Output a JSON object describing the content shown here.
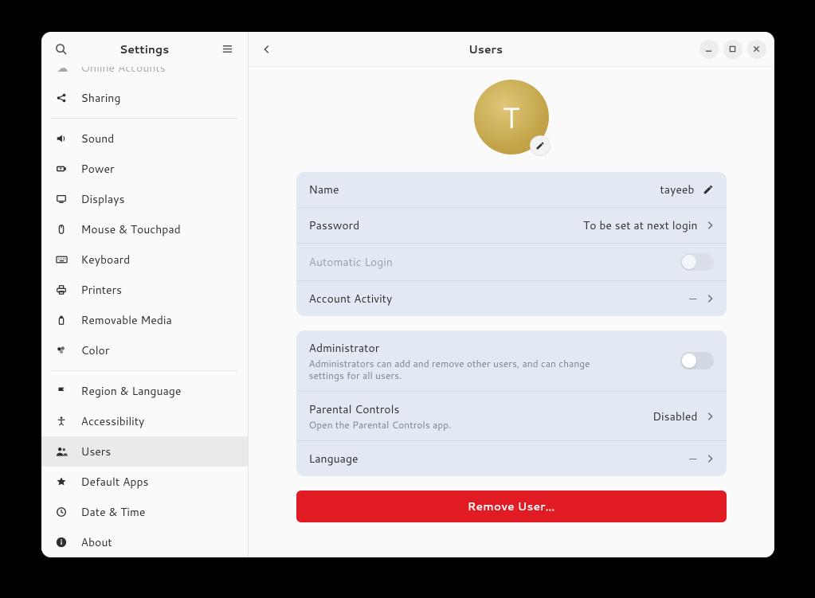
{
  "sidebar": {
    "title": "Settings",
    "items": [
      {
        "id": "online-accounts",
        "label": "Online Accounts",
        "icon": "cloud"
      },
      {
        "id": "sharing",
        "label": "Sharing",
        "icon": "share"
      },
      null,
      {
        "id": "sound",
        "label": "Sound",
        "icon": "speaker"
      },
      {
        "id": "power",
        "label": "Power",
        "icon": "power"
      },
      {
        "id": "displays",
        "label": "Displays",
        "icon": "display"
      },
      {
        "id": "mouse",
        "label": "Mouse & Touchpad",
        "icon": "mouse"
      },
      {
        "id": "keyboard",
        "label": "Keyboard",
        "icon": "keyboard"
      },
      {
        "id": "printers",
        "label": "Printers",
        "icon": "printer"
      },
      {
        "id": "removable",
        "label": "Removable Media",
        "icon": "usb"
      },
      {
        "id": "color",
        "label": "Color",
        "icon": "palette"
      },
      null,
      {
        "id": "region",
        "label": "Region & Language",
        "icon": "flag"
      },
      {
        "id": "accessibility",
        "label": "Accessibility",
        "icon": "a11y"
      },
      {
        "id": "users",
        "label": "Users",
        "icon": "users"
      },
      {
        "id": "default-apps",
        "label": "Default Apps",
        "icon": "star"
      },
      {
        "id": "datetime",
        "label": "Date & Time",
        "icon": "clock"
      },
      {
        "id": "about",
        "label": "About",
        "icon": "info"
      }
    ],
    "active": "users"
  },
  "header": {
    "title": "Users"
  },
  "user": {
    "initial": "T",
    "name_label": "Name",
    "name_value": "tayeeb",
    "password_label": "Password",
    "password_value": "To be set at next login",
    "autologin_label": "Automatic Login",
    "autologin_enabled": false,
    "activity_label": "Account Activity",
    "activity_value": "—",
    "admin_label": "Administrator",
    "admin_desc": "Administrators can add and remove other users, and can change settings for all users.",
    "admin_enabled": false,
    "parental_label": "Parental Controls",
    "parental_desc": "Open the Parental Controls app.",
    "parental_value": "Disabled",
    "language_label": "Language",
    "language_value": "—",
    "remove_label": "Remove User…"
  }
}
